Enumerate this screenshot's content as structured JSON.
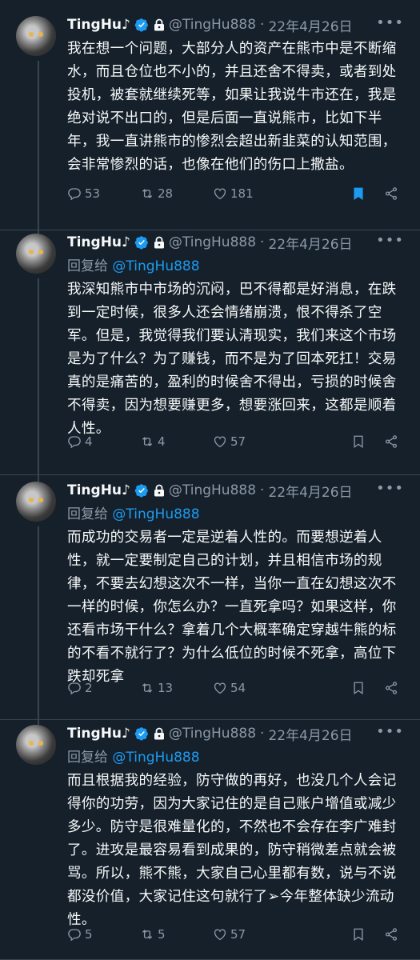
{
  "author": {
    "name": "TingHu♪",
    "handle": "@TingHu888",
    "separator": "·",
    "date": "22年4月26日"
  },
  "colors": {
    "background": "#15202b",
    "accent": "#1d9bf0",
    "muted": "#8b98a5",
    "text": "#f7f9f9"
  },
  "icons": {
    "verified": "verified-badge-icon",
    "protected": "lock-icon",
    "more": "more-icon",
    "reply": "comment-icon",
    "retweet": "retweet-icon",
    "like": "heart-icon",
    "bookmark": "bookmark-icon",
    "share": "share-icon"
  },
  "tweets": [
    {
      "reply_prefix": "",
      "reply_mention": "",
      "text": "我在想一个问题，大部分人的资产在熊市中是不断缩水，而且仓位也不小的，并且还舍不得卖，或者到处投机，被套就继续死等，如果让我说牛市还在，我是绝对说不出口的，但是后面一直说熊市，比如下半年，我一直讲熊市的惨烈会超出新韭菜的认知范围，会非常惨烈的话，也像在他们的伤口上撒盐。",
      "replies": "53",
      "retweets": "28",
      "likes": "181",
      "bookmarked": true
    },
    {
      "reply_prefix": "回复给",
      "reply_mention": "@TingHu888",
      "text": "我深知熊市中市场的沉闷，巴不得都是好消息，在跌到一定时候，很多人还会情绪崩溃，恨不得杀了空军。但是，我觉得我们要认清现实，我们来这个市场是为了什么？为了赚钱，而不是为了回本死扛！交易真的是痛苦的，盈利的时候舍不得出，亏损的时候舍不得卖，因为想要赚更多，想要涨回来，这都是顺着人性。",
      "replies": "4",
      "retweets": "4",
      "likes": "57",
      "bookmarked": false
    },
    {
      "reply_prefix": "回复给",
      "reply_mention": "@TingHu888",
      "text": "而成功的交易者一定是逆着人性的。而要想逆着人性，就一定要制定自己的计划，并且相信市场的规律，不要去幻想这次不一样，当你一直在幻想这次不一样的时候，你怎么办？一直死拿吗？如果这样，你还看市场干什么？拿着几个大概率确定穿越牛熊的标的不看不就行了？为什么低位的时候不死拿，高位下跌却死拿",
      "replies": "2",
      "retweets": "13",
      "likes": "54",
      "bookmarked": false
    },
    {
      "reply_prefix": "回复给",
      "reply_mention": "@TingHu888",
      "text": "而且根据我的经验，防守做的再好，也没几个人会记得你的功劳，因为大家记住的是自己账户增值或减少多少。防守是很难量化的，不然也不会存在李广难封了。进攻是最容易看到成果的，防守稍微差点就会被骂。所以，熊不熊，大家自己心里都有数，说与不说都没价值，大家记住这句就行了➢今年整体缺少流动性。",
      "replies": "5",
      "retweets": "5",
      "likes": "57",
      "bookmarked": false
    }
  ]
}
